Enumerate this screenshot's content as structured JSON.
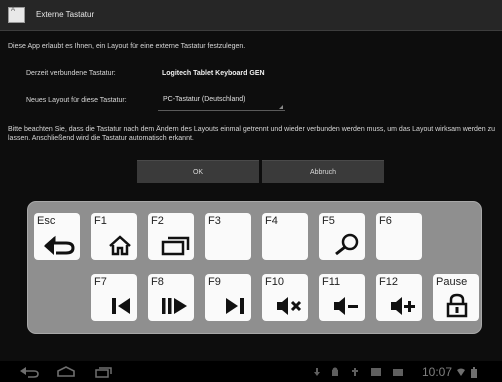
{
  "dialog": {
    "title": "Externe Tastatur",
    "intro": "Diese App erlaubt es Ihnen, ein Layout für eine externe Tastatur festzulegen.",
    "connected_label": "Derzeit verbundene Tastatur:",
    "connected_value": "Logitech Tablet Keyboard GEN",
    "layout_label": "Neues Layout für diese Tastatur:",
    "layout_value": "PC-Tastatur (Deutschland)",
    "note": "Bitte beachten Sie, dass die Tastatur nach dem Ändern des Layouts einmal getrennt und wieder verbunden werden muss, um das Layout wirksam werden zu lassen. Anschließend wird die Tastatur automatisch erkannt.",
    "ok_label": "OK",
    "cancel_label": "Abbruch"
  },
  "keyboard": {
    "row1": [
      {
        "label": "Esc",
        "icon": "back-arrow-icon"
      },
      {
        "label": "F1",
        "icon": "home-icon"
      },
      {
        "label": "F2",
        "icon": "recent-apps-icon"
      },
      {
        "label": "F3",
        "icon": ""
      },
      {
        "label": "F4",
        "icon": ""
      },
      {
        "label": "F5",
        "icon": "search-icon"
      },
      {
        "label": "F6",
        "icon": ""
      }
    ],
    "row2": [
      {
        "label": "F7",
        "icon": "previous-track-icon"
      },
      {
        "label": "F8",
        "icon": "play-pause-icon"
      },
      {
        "label": "F9",
        "icon": "next-track-icon"
      },
      {
        "label": "F10",
        "icon": "mute-icon"
      },
      {
        "label": "F11",
        "icon": "volume-down-icon"
      },
      {
        "label": "F12",
        "icon": "volume-up-icon"
      },
      {
        "label": "Pause",
        "icon": "lock-icon"
      }
    ]
  },
  "statusbar": {
    "time": "10:07"
  }
}
